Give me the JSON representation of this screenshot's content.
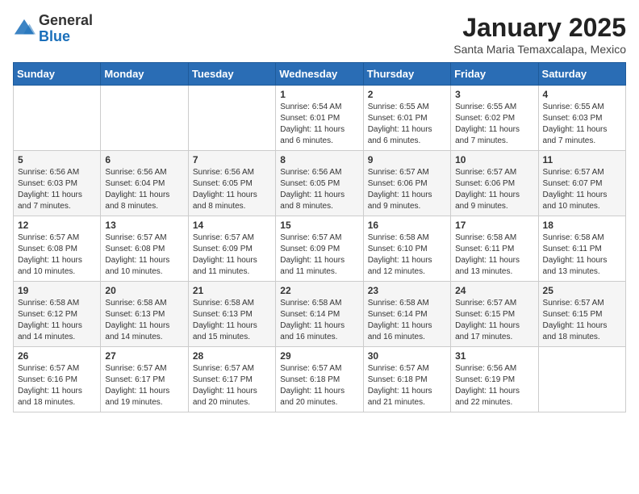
{
  "header": {
    "logo_general": "General",
    "logo_blue": "Blue",
    "month_title": "January 2025",
    "location": "Santa Maria Temaxcalapa, Mexico"
  },
  "weekdays": [
    "Sunday",
    "Monday",
    "Tuesday",
    "Wednesday",
    "Thursday",
    "Friday",
    "Saturday"
  ],
  "weeks": [
    [
      {
        "day": "",
        "info": ""
      },
      {
        "day": "",
        "info": ""
      },
      {
        "day": "",
        "info": ""
      },
      {
        "day": "1",
        "info": "Sunrise: 6:54 AM\nSunset: 6:01 PM\nDaylight: 11 hours and 6 minutes."
      },
      {
        "day": "2",
        "info": "Sunrise: 6:55 AM\nSunset: 6:01 PM\nDaylight: 11 hours and 6 minutes."
      },
      {
        "day": "3",
        "info": "Sunrise: 6:55 AM\nSunset: 6:02 PM\nDaylight: 11 hours and 7 minutes."
      },
      {
        "day": "4",
        "info": "Sunrise: 6:55 AM\nSunset: 6:03 PM\nDaylight: 11 hours and 7 minutes."
      }
    ],
    [
      {
        "day": "5",
        "info": "Sunrise: 6:56 AM\nSunset: 6:03 PM\nDaylight: 11 hours and 7 minutes."
      },
      {
        "day": "6",
        "info": "Sunrise: 6:56 AM\nSunset: 6:04 PM\nDaylight: 11 hours and 8 minutes."
      },
      {
        "day": "7",
        "info": "Sunrise: 6:56 AM\nSunset: 6:05 PM\nDaylight: 11 hours and 8 minutes."
      },
      {
        "day": "8",
        "info": "Sunrise: 6:56 AM\nSunset: 6:05 PM\nDaylight: 11 hours and 8 minutes."
      },
      {
        "day": "9",
        "info": "Sunrise: 6:57 AM\nSunset: 6:06 PM\nDaylight: 11 hours and 9 minutes."
      },
      {
        "day": "10",
        "info": "Sunrise: 6:57 AM\nSunset: 6:06 PM\nDaylight: 11 hours and 9 minutes."
      },
      {
        "day": "11",
        "info": "Sunrise: 6:57 AM\nSunset: 6:07 PM\nDaylight: 11 hours and 10 minutes."
      }
    ],
    [
      {
        "day": "12",
        "info": "Sunrise: 6:57 AM\nSunset: 6:08 PM\nDaylight: 11 hours and 10 minutes."
      },
      {
        "day": "13",
        "info": "Sunrise: 6:57 AM\nSunset: 6:08 PM\nDaylight: 11 hours and 10 minutes."
      },
      {
        "day": "14",
        "info": "Sunrise: 6:57 AM\nSunset: 6:09 PM\nDaylight: 11 hours and 11 minutes."
      },
      {
        "day": "15",
        "info": "Sunrise: 6:57 AM\nSunset: 6:09 PM\nDaylight: 11 hours and 11 minutes."
      },
      {
        "day": "16",
        "info": "Sunrise: 6:58 AM\nSunset: 6:10 PM\nDaylight: 11 hours and 12 minutes."
      },
      {
        "day": "17",
        "info": "Sunrise: 6:58 AM\nSunset: 6:11 PM\nDaylight: 11 hours and 13 minutes."
      },
      {
        "day": "18",
        "info": "Sunrise: 6:58 AM\nSunset: 6:11 PM\nDaylight: 11 hours and 13 minutes."
      }
    ],
    [
      {
        "day": "19",
        "info": "Sunrise: 6:58 AM\nSunset: 6:12 PM\nDaylight: 11 hours and 14 minutes."
      },
      {
        "day": "20",
        "info": "Sunrise: 6:58 AM\nSunset: 6:13 PM\nDaylight: 11 hours and 14 minutes."
      },
      {
        "day": "21",
        "info": "Sunrise: 6:58 AM\nSunset: 6:13 PM\nDaylight: 11 hours and 15 minutes."
      },
      {
        "day": "22",
        "info": "Sunrise: 6:58 AM\nSunset: 6:14 PM\nDaylight: 11 hours and 16 minutes."
      },
      {
        "day": "23",
        "info": "Sunrise: 6:58 AM\nSunset: 6:14 PM\nDaylight: 11 hours and 16 minutes."
      },
      {
        "day": "24",
        "info": "Sunrise: 6:57 AM\nSunset: 6:15 PM\nDaylight: 11 hours and 17 minutes."
      },
      {
        "day": "25",
        "info": "Sunrise: 6:57 AM\nSunset: 6:15 PM\nDaylight: 11 hours and 18 minutes."
      }
    ],
    [
      {
        "day": "26",
        "info": "Sunrise: 6:57 AM\nSunset: 6:16 PM\nDaylight: 11 hours and 18 minutes."
      },
      {
        "day": "27",
        "info": "Sunrise: 6:57 AM\nSunset: 6:17 PM\nDaylight: 11 hours and 19 minutes."
      },
      {
        "day": "28",
        "info": "Sunrise: 6:57 AM\nSunset: 6:17 PM\nDaylight: 11 hours and 20 minutes."
      },
      {
        "day": "29",
        "info": "Sunrise: 6:57 AM\nSunset: 6:18 PM\nDaylight: 11 hours and 20 minutes."
      },
      {
        "day": "30",
        "info": "Sunrise: 6:57 AM\nSunset: 6:18 PM\nDaylight: 11 hours and 21 minutes."
      },
      {
        "day": "31",
        "info": "Sunrise: 6:56 AM\nSunset: 6:19 PM\nDaylight: 11 hours and 22 minutes."
      },
      {
        "day": "",
        "info": ""
      }
    ]
  ]
}
